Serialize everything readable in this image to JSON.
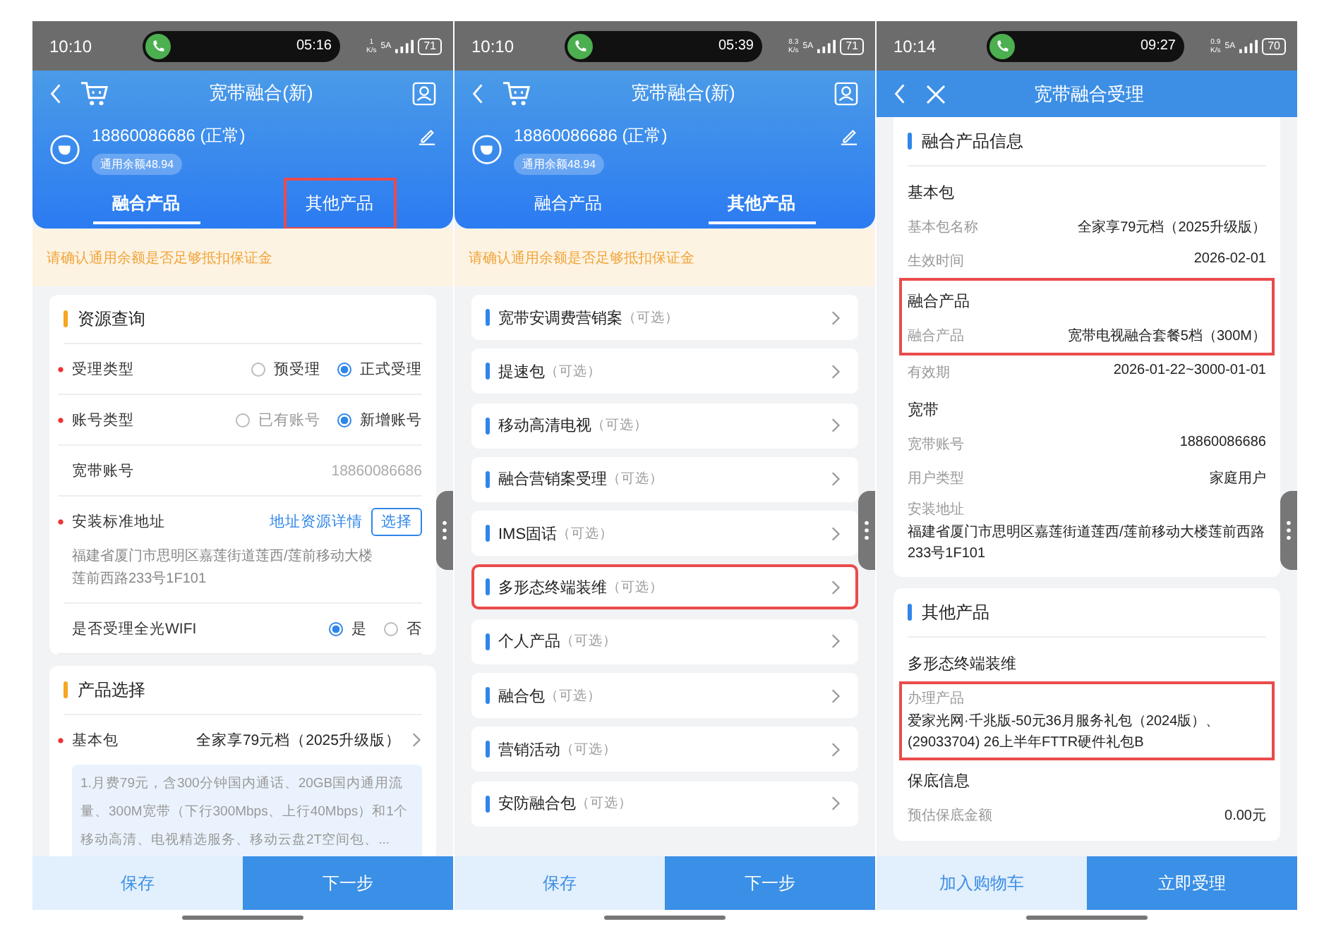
{
  "phones": [
    {
      "status": {
        "time": "10:10",
        "call_timer": "05:16",
        "net_speed": "1",
        "net_unit": "K/s",
        "signal_label": "5A",
        "battery": "71"
      },
      "header": {
        "kind": "customer",
        "title": "宽带融合(新)",
        "phone": "18860086686 (正常)",
        "balance": "通用余额48.94",
        "tabs": [
          {
            "label": "融合产品",
            "selected": true,
            "highlighted": false
          },
          {
            "label": "其他产品",
            "selected": false,
            "highlighted": true
          }
        ]
      },
      "notice": "请确认通用余额是否足够抵扣保证金",
      "body": {
        "kind": "form",
        "sections": [
          {
            "title": "资源查询",
            "rows": [
              {
                "kind": "radio",
                "required": true,
                "label": "受理类型",
                "options": [
                  {
                    "label": "预受理",
                    "selected": false,
                    "disabled": false
                  },
                  {
                    "label": "正式受理",
                    "selected": true,
                    "disabled": false
                  }
                ]
              },
              {
                "kind": "radio",
                "required": true,
                "label": "账号类型",
                "options": [
                  {
                    "label": "已有账号",
                    "selected": false,
                    "disabled": true
                  },
                  {
                    "label": "新增账号",
                    "selected": true,
                    "disabled": false
                  }
                ]
              },
              {
                "kind": "value",
                "required": false,
                "label": "宽带账号",
                "value": "18860086686"
              },
              {
                "kind": "address",
                "required": true,
                "label": "安装标准地址",
                "link": "地址资源详情",
                "button": "选择",
                "address": "福建省厦门市思明区嘉莲街道莲西/莲前移动大楼莲前西路233号1F101"
              },
              {
                "kind": "radio",
                "required": false,
                "label": "是否受理全光WIFI",
                "options": [
                  {
                    "label": "是",
                    "selected": true,
                    "disabled": false
                  },
                  {
                    "label": "否",
                    "selected": false,
                    "disabled": false
                  }
                ]
              }
            ]
          },
          {
            "title": "产品选择",
            "rows": [
              {
                "kind": "select",
                "required": true,
                "label": "基本包",
                "value": "全家享79元档（2025升级版）"
              },
              {
                "kind": "description",
                "text": "1.月费79元，含300分钟国内通话、20GB国内通用流量、300M宽带（下行300Mbps、上行40Mbps）和1个移动高清、电视精选服务、移动云盘2T空间包、..."
              }
            ]
          }
        ]
      },
      "footer": [
        {
          "label": "保存",
          "kind": "secondary"
        },
        {
          "label": "下一步",
          "kind": "primary"
        }
      ]
    },
    {
      "status": {
        "time": "10:10",
        "call_timer": "05:39",
        "net_speed": "8.3",
        "net_unit": "K/s",
        "signal_label": "5A",
        "battery": "71"
      },
      "header": {
        "kind": "customer",
        "title": "宽带融合(新)",
        "phone": "18860086686 (正常)",
        "balance": "通用余额48.94",
        "tabs": [
          {
            "label": "融合产品",
            "selected": false,
            "highlighted": false
          },
          {
            "label": "其他产品",
            "selected": true,
            "highlighted": false
          }
        ]
      },
      "notice": "请确认通用余额是否足够抵扣保证金",
      "body": {
        "kind": "list",
        "items": [
          {
            "label": "宽带安调费营销案",
            "hint": "（可选）",
            "highlighted": false
          },
          {
            "label": "提速包",
            "hint": "（可选）",
            "highlighted": false
          },
          {
            "label": "移动高清电视",
            "hint": "（可选）",
            "highlighted": false
          },
          {
            "label": "融合营销案受理",
            "hint": "（可选）",
            "highlighted": false
          },
          {
            "label": "IMS固话",
            "hint": "（可选）",
            "highlighted": false
          },
          {
            "label": "多形态终端装维",
            "hint": "（可选）",
            "highlighted": true
          },
          {
            "label": "个人产品",
            "hint": "（可选）",
            "highlighted": false
          },
          {
            "label": "融合包",
            "hint": "（可选）",
            "highlighted": false
          },
          {
            "label": "营销活动",
            "hint": "（可选）",
            "highlighted": false
          },
          {
            "label": "安防融合包",
            "hint": "（可选）",
            "highlighted": false
          }
        ]
      },
      "footer": [
        {
          "label": "保存",
          "kind": "secondary"
        },
        {
          "label": "下一步",
          "kind": "primary"
        }
      ]
    },
    {
      "status": {
        "time": "10:14",
        "call_timer": "09:27",
        "net_speed": "0.9",
        "net_unit": "K/s",
        "signal_label": "5A",
        "battery": "70"
      },
      "header": {
        "kind": "simple",
        "title": "宽带融合受理"
      },
      "body": {
        "kind": "detail",
        "cards": [
          {
            "title": "融合产品信息",
            "lines": [
              {
                "kind": "heading",
                "text": "基本包"
              },
              {
                "kind": "row",
                "label": "基本包名称",
                "value": "全家享79元档（2025升级版）"
              },
              {
                "kind": "row",
                "label": "生效时间",
                "value": "2026-02-01"
              },
              {
                "kind": "highlight",
                "lines": [
                  {
                    "kind": "heading",
                    "text": "融合产品"
                  },
                  {
                    "kind": "row",
                    "label": "融合产品",
                    "value": "宽带电视融合套餐5档（300M）"
                  }
                ]
              },
              {
                "kind": "row",
                "label": "有效期",
                "value": "2026-01-22~3000-01-01"
              },
              {
                "kind": "heading",
                "text": "宽带"
              },
              {
                "kind": "row",
                "label": "宽带账号",
                "value": "18860086686"
              },
              {
                "kind": "row",
                "label": "用户类型",
                "value": "家庭用户"
              },
              {
                "kind": "stacked",
                "label": "安装地址",
                "value": "福建省厦门市思明区嘉莲街道莲西/莲前移动大楼莲前西路233号1F101"
              }
            ]
          },
          {
            "title": "其他产品",
            "lines": [
              {
                "kind": "heading",
                "text": "多形态终端装维"
              },
              {
                "kind": "highlight",
                "lines": [
                  {
                    "kind": "stacked",
                    "label": "办理产品",
                    "value": "爱家光网·千兆版-50元36月服务礼包（2024版）、(29033704) 26上半年FTTR硬件礼包B"
                  }
                ]
              },
              {
                "kind": "heading",
                "text": "保底信息"
              },
              {
                "kind": "row",
                "label": "预估保底金额",
                "value": "0.00元"
              }
            ]
          }
        ]
      },
      "footer": [
        {
          "label": "加入购物车",
          "kind": "secondary"
        },
        {
          "label": "立即受理",
          "kind": "primary"
        }
      ]
    }
  ]
}
